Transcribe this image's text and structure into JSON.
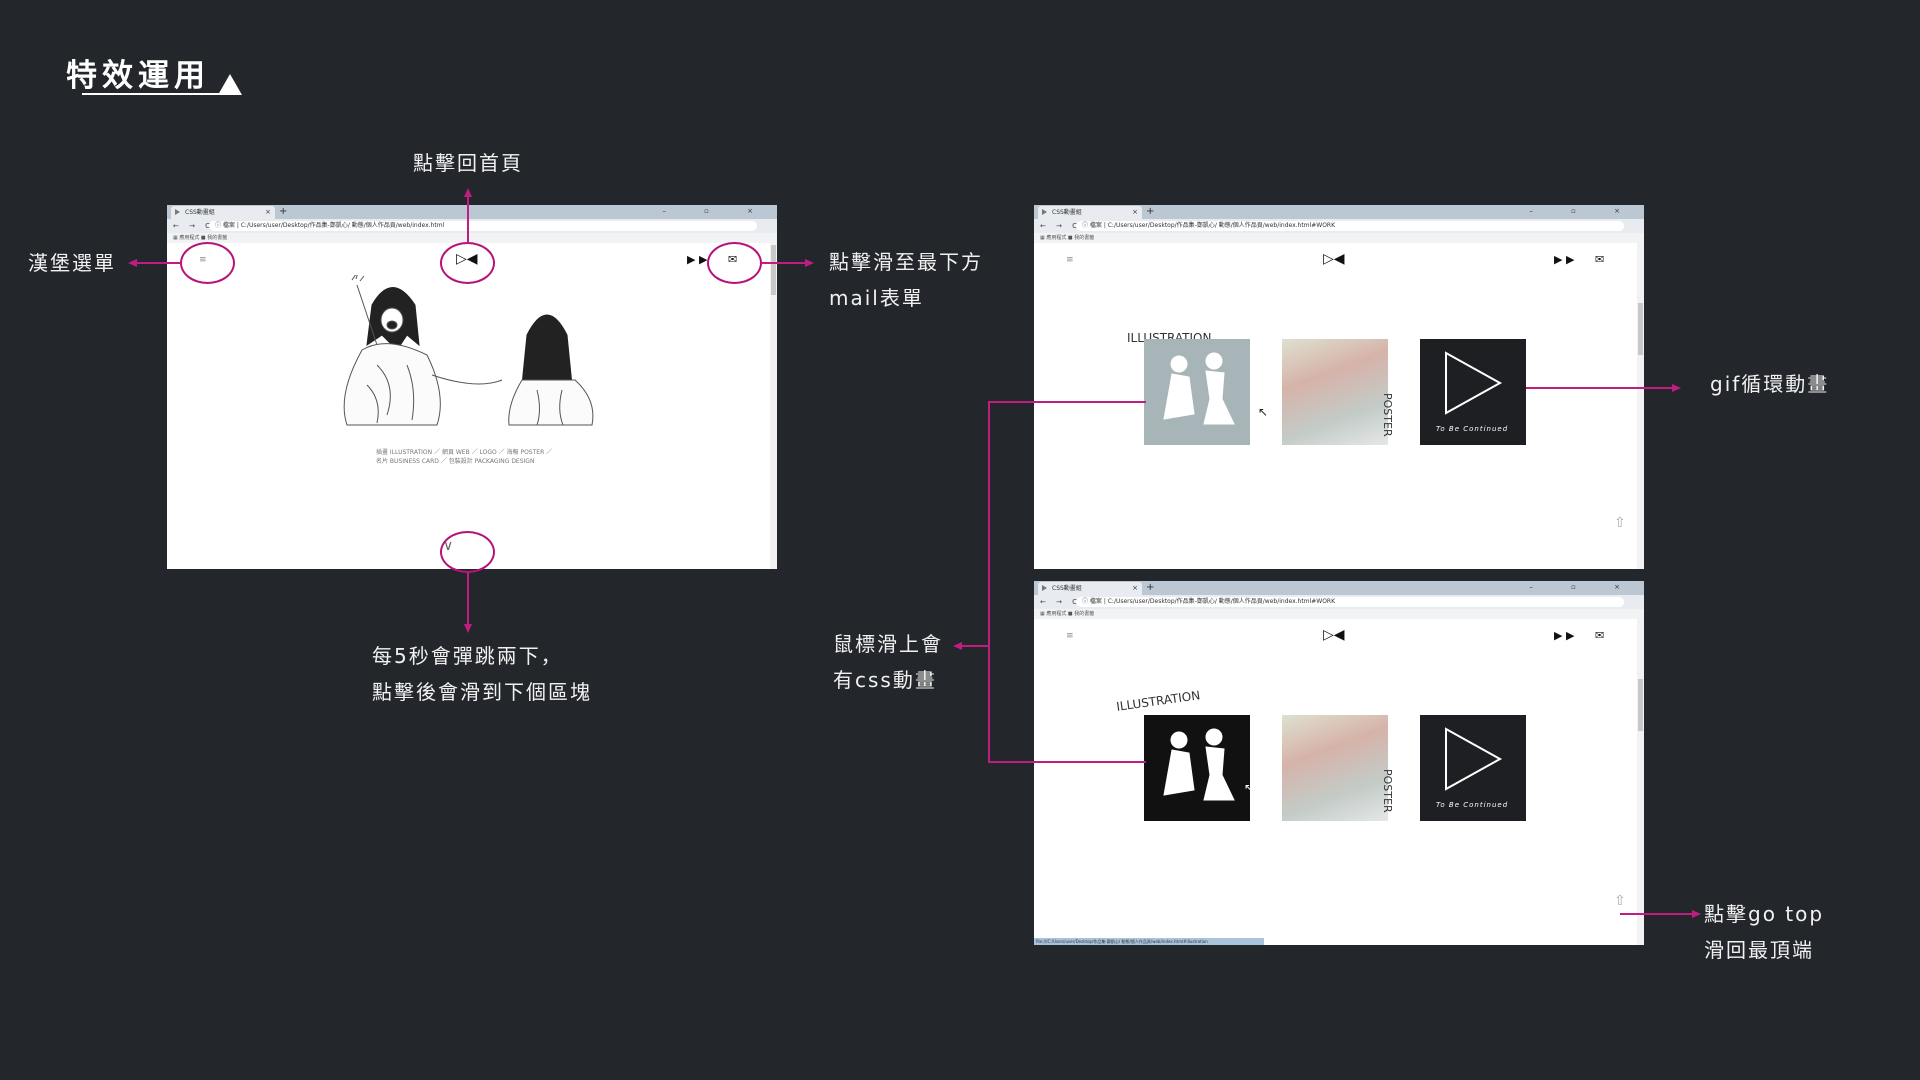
{
  "title": "特效運用",
  "annotations": {
    "hamburger": "漢堡選單",
    "home_click": "點擊回首頁",
    "scroll_bottom_line1": "點擊滑至最下方",
    "scroll_bottom_line2": "mail表單",
    "bounce_line1": "每5秒會彈跳兩下，",
    "bounce_line2": "點擊後會滑到下個區塊",
    "gif_loop": "gif循環動畫",
    "hover_line1": "鼠標滑上會",
    "hover_line2": "有css動畫",
    "gotop_line1": "點擊go top",
    "gotop_line2": "滑回最頂端"
  },
  "browser": {
    "tab_title": "CSS動畫組",
    "new_tab": "+",
    "window_controls": "– ▫ ×",
    "nav_buttons": "← → C",
    "url_home": "ⓘ 檔案 | C:/Users/user/Desktop/作品集-鄭凱心/ 動態/個人作品頁/web/index.html",
    "url_work": "ⓘ 檔案 | C:/Users/user/Desktop/作品集-鄭凱心/ 動態/個人作品頁/web/index.html#WORK",
    "bookmarks": "▦ 應用程式    ■ 我的書籤",
    "status_bar": "file:///C:/Users/user/Desktop/作品集-鄭凱心/ 動態/個人作品頁/web/index.html#illustration"
  },
  "site": {
    "menu_icon": "≡",
    "logo_icon": "▷◀",
    "play_icons": "▶ ▶",
    "mail_icon": "✉",
    "caption_line1": "插畫 ILLUSTRATION ／ 網頁 WEB ／ LOGO ／ 海報 POSTER ／",
    "caption_line2": "名片 BUSINESS CARD ／ 包裝設計 PACKAGING DESIGN",
    "down_icon": "∨",
    "gotop_icon": "⇧",
    "illustration_label": "ILLUSTRATION",
    "poster_label": "POSTER",
    "continued_text": "To Be Continued"
  },
  "colors": {
    "background": "#23272b",
    "accent": "#c11d81"
  }
}
